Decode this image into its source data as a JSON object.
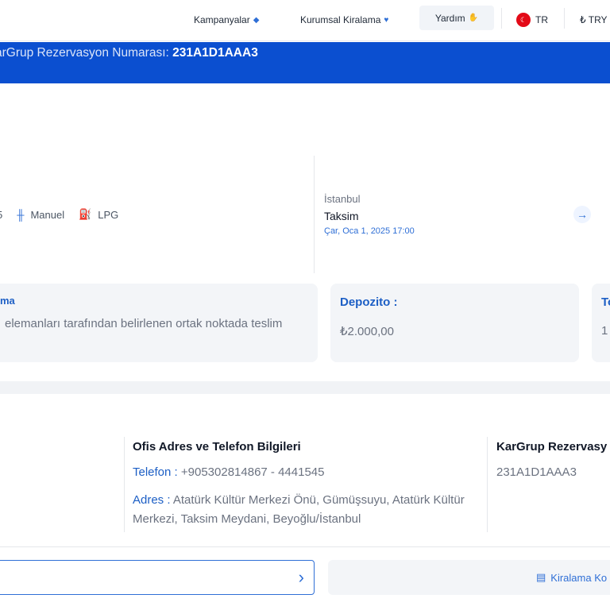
{
  "nav": {
    "campaigns": "Kampanyalar",
    "corporate": "Kurumsal Kiralama",
    "help": "Yardım",
    "language": "TR",
    "currency": "₺ TRY"
  },
  "banner": {
    "label": "arGrup Rezervasyon Numarası:",
    "number": "231A1D1AAA3"
  },
  "car": {
    "specs": [
      {
        "icon": "seat-icon",
        "label": "5"
      },
      {
        "icon": "gear-shift-icon",
        "label": "Manuel"
      },
      {
        "icon": "fuel-pump-icon",
        "label": "LPG"
      }
    ]
  },
  "location": {
    "city": "İstanbul",
    "place": "Taksim",
    "datetime": "Çar, Oca 1, 2025 17:00"
  },
  "cards": {
    "delivery": {
      "title": "ma",
      "body": "elemanları tarafından belirlenen ortak noktada teslim"
    },
    "deposit": {
      "title": "Depozito :",
      "body": "₺2.000,00"
    },
    "total": {
      "title": "To",
      "body": "1"
    }
  },
  "office": {
    "title": "Ofis Adres ve Telefon Bilgileri",
    "phone_label": "Telefon :",
    "phone_value": "+905302814867 - 4441545",
    "address_label": "Adres :",
    "address_value": "Atatürk Kültür Merkezi Önü, Gümüşsuyu, Atatürk Kültür Merkezi, Taksim Meydani, Beyoğlu/İstanbul"
  },
  "reservation": {
    "title": "KarGrup Rezervasy",
    "number": "231A1D1AAA3"
  },
  "actions": {
    "rental_button": "Kiralama Ko"
  },
  "colors": {
    "brand_blue": "#0b4fd0",
    "accent_blue": "#1d5fc5",
    "card_bg": "#f3f5f8"
  }
}
